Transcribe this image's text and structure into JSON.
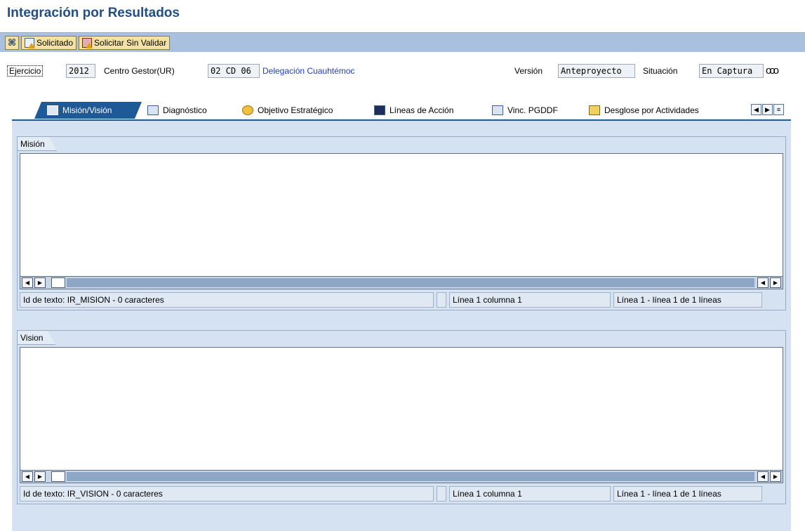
{
  "title": "Integración por Resultados",
  "toolbar": {
    "solicitado_label": "Solicitado",
    "solicitar_sin_validar_label": "Solicitar Sin Validar"
  },
  "header": {
    "ejercicio_label": "Ejercicio",
    "ejercicio_value": "2012",
    "centro_gestor_label": "Centro Gestor(UR)",
    "centro_gestor_value": "02 CD 06",
    "centro_gestor_desc": "Delegación Cuauhtémoc",
    "version_label": "Versión",
    "version_value": "Anteproyecto",
    "situacion_label": "Situación",
    "situacion_value": "En Captura",
    "status_icon": "ooo"
  },
  "tabs": [
    {
      "label": "Misión/Visión",
      "icon": "people-icon",
      "active": true
    },
    {
      "label": "Diagnóstico",
      "icon": "window-icon",
      "active": false
    },
    {
      "label": "Objetivo Estratégico",
      "icon": "target-icon",
      "active": false
    },
    {
      "label": "Líneas de Acción",
      "icon": "grid-icon",
      "active": false
    },
    {
      "label": "Vinc. PGDDF",
      "icon": "document-icon",
      "active": false
    },
    {
      "label": "Desglose por Actividades",
      "icon": "pencil-icon",
      "active": false
    }
  ],
  "mision": {
    "title": "Misión",
    "text_id": "Id de texto: IR_MISION - 0 caracteres",
    "position": "Línea 1 columna 1",
    "lines": "Línea 1 - línea 1 de 1 líneas"
  },
  "vision": {
    "title": "Vision",
    "text_id": "Id de texto: IR_VISION - 0 caracteres",
    "position": "Línea 1 columna 1",
    "lines": "Línea 1 - línea 1 de 1 líneas"
  }
}
